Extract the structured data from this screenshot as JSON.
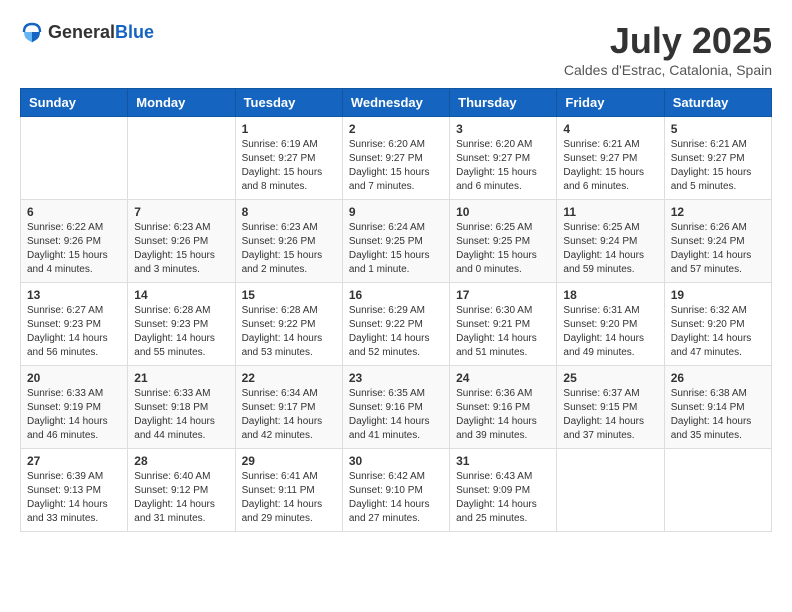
{
  "header": {
    "logo_general": "General",
    "logo_blue": "Blue",
    "month_title": "July 2025",
    "location": "Caldes d'Estrac, Catalonia, Spain"
  },
  "weekdays": [
    "Sunday",
    "Monday",
    "Tuesday",
    "Wednesday",
    "Thursday",
    "Friday",
    "Saturday"
  ],
  "weeks": [
    [
      {
        "day": "",
        "sunrise": "",
        "sunset": "",
        "daylight": ""
      },
      {
        "day": "",
        "sunrise": "",
        "sunset": "",
        "daylight": ""
      },
      {
        "day": "1",
        "sunrise": "Sunrise: 6:19 AM",
        "sunset": "Sunset: 9:27 PM",
        "daylight": "Daylight: 15 hours and 8 minutes."
      },
      {
        "day": "2",
        "sunrise": "Sunrise: 6:20 AM",
        "sunset": "Sunset: 9:27 PM",
        "daylight": "Daylight: 15 hours and 7 minutes."
      },
      {
        "day": "3",
        "sunrise": "Sunrise: 6:20 AM",
        "sunset": "Sunset: 9:27 PM",
        "daylight": "Daylight: 15 hours and 6 minutes."
      },
      {
        "day": "4",
        "sunrise": "Sunrise: 6:21 AM",
        "sunset": "Sunset: 9:27 PM",
        "daylight": "Daylight: 15 hours and 6 minutes."
      },
      {
        "day": "5",
        "sunrise": "Sunrise: 6:21 AM",
        "sunset": "Sunset: 9:27 PM",
        "daylight": "Daylight: 15 hours and 5 minutes."
      }
    ],
    [
      {
        "day": "6",
        "sunrise": "Sunrise: 6:22 AM",
        "sunset": "Sunset: 9:26 PM",
        "daylight": "Daylight: 15 hours and 4 minutes."
      },
      {
        "day": "7",
        "sunrise": "Sunrise: 6:23 AM",
        "sunset": "Sunset: 9:26 PM",
        "daylight": "Daylight: 15 hours and 3 minutes."
      },
      {
        "day": "8",
        "sunrise": "Sunrise: 6:23 AM",
        "sunset": "Sunset: 9:26 PM",
        "daylight": "Daylight: 15 hours and 2 minutes."
      },
      {
        "day": "9",
        "sunrise": "Sunrise: 6:24 AM",
        "sunset": "Sunset: 9:25 PM",
        "daylight": "Daylight: 15 hours and 1 minute."
      },
      {
        "day": "10",
        "sunrise": "Sunrise: 6:25 AM",
        "sunset": "Sunset: 9:25 PM",
        "daylight": "Daylight: 15 hours and 0 minutes."
      },
      {
        "day": "11",
        "sunrise": "Sunrise: 6:25 AM",
        "sunset": "Sunset: 9:24 PM",
        "daylight": "Daylight: 14 hours and 59 minutes."
      },
      {
        "day": "12",
        "sunrise": "Sunrise: 6:26 AM",
        "sunset": "Sunset: 9:24 PM",
        "daylight": "Daylight: 14 hours and 57 minutes."
      }
    ],
    [
      {
        "day": "13",
        "sunrise": "Sunrise: 6:27 AM",
        "sunset": "Sunset: 9:23 PM",
        "daylight": "Daylight: 14 hours and 56 minutes."
      },
      {
        "day": "14",
        "sunrise": "Sunrise: 6:28 AM",
        "sunset": "Sunset: 9:23 PM",
        "daylight": "Daylight: 14 hours and 55 minutes."
      },
      {
        "day": "15",
        "sunrise": "Sunrise: 6:28 AM",
        "sunset": "Sunset: 9:22 PM",
        "daylight": "Daylight: 14 hours and 53 minutes."
      },
      {
        "day": "16",
        "sunrise": "Sunrise: 6:29 AM",
        "sunset": "Sunset: 9:22 PM",
        "daylight": "Daylight: 14 hours and 52 minutes."
      },
      {
        "day": "17",
        "sunrise": "Sunrise: 6:30 AM",
        "sunset": "Sunset: 9:21 PM",
        "daylight": "Daylight: 14 hours and 51 minutes."
      },
      {
        "day": "18",
        "sunrise": "Sunrise: 6:31 AM",
        "sunset": "Sunset: 9:20 PM",
        "daylight": "Daylight: 14 hours and 49 minutes."
      },
      {
        "day": "19",
        "sunrise": "Sunrise: 6:32 AM",
        "sunset": "Sunset: 9:20 PM",
        "daylight": "Daylight: 14 hours and 47 minutes."
      }
    ],
    [
      {
        "day": "20",
        "sunrise": "Sunrise: 6:33 AM",
        "sunset": "Sunset: 9:19 PM",
        "daylight": "Daylight: 14 hours and 46 minutes."
      },
      {
        "day": "21",
        "sunrise": "Sunrise: 6:33 AM",
        "sunset": "Sunset: 9:18 PM",
        "daylight": "Daylight: 14 hours and 44 minutes."
      },
      {
        "day": "22",
        "sunrise": "Sunrise: 6:34 AM",
        "sunset": "Sunset: 9:17 PM",
        "daylight": "Daylight: 14 hours and 42 minutes."
      },
      {
        "day": "23",
        "sunrise": "Sunrise: 6:35 AM",
        "sunset": "Sunset: 9:16 PM",
        "daylight": "Daylight: 14 hours and 41 minutes."
      },
      {
        "day": "24",
        "sunrise": "Sunrise: 6:36 AM",
        "sunset": "Sunset: 9:16 PM",
        "daylight": "Daylight: 14 hours and 39 minutes."
      },
      {
        "day": "25",
        "sunrise": "Sunrise: 6:37 AM",
        "sunset": "Sunset: 9:15 PM",
        "daylight": "Daylight: 14 hours and 37 minutes."
      },
      {
        "day": "26",
        "sunrise": "Sunrise: 6:38 AM",
        "sunset": "Sunset: 9:14 PM",
        "daylight": "Daylight: 14 hours and 35 minutes."
      }
    ],
    [
      {
        "day": "27",
        "sunrise": "Sunrise: 6:39 AM",
        "sunset": "Sunset: 9:13 PM",
        "daylight": "Daylight: 14 hours and 33 minutes."
      },
      {
        "day": "28",
        "sunrise": "Sunrise: 6:40 AM",
        "sunset": "Sunset: 9:12 PM",
        "daylight": "Daylight: 14 hours and 31 minutes."
      },
      {
        "day": "29",
        "sunrise": "Sunrise: 6:41 AM",
        "sunset": "Sunset: 9:11 PM",
        "daylight": "Daylight: 14 hours and 29 minutes."
      },
      {
        "day": "30",
        "sunrise": "Sunrise: 6:42 AM",
        "sunset": "Sunset: 9:10 PM",
        "daylight": "Daylight: 14 hours and 27 minutes."
      },
      {
        "day": "31",
        "sunrise": "Sunrise: 6:43 AM",
        "sunset": "Sunset: 9:09 PM",
        "daylight": "Daylight: 14 hours and 25 minutes."
      },
      {
        "day": "",
        "sunrise": "",
        "sunset": "",
        "daylight": ""
      },
      {
        "day": "",
        "sunrise": "",
        "sunset": "",
        "daylight": ""
      }
    ]
  ]
}
